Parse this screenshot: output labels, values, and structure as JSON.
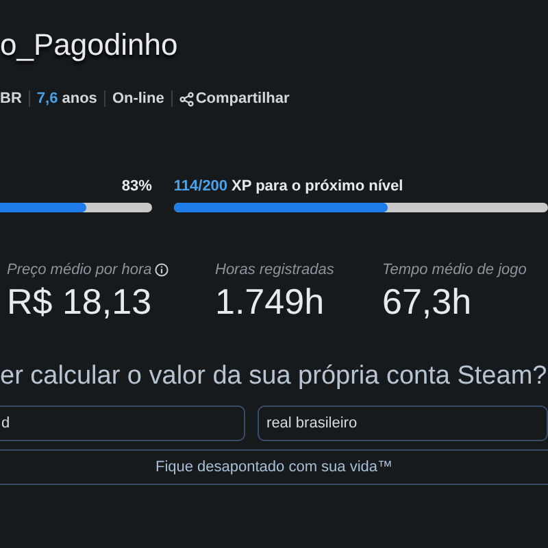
{
  "profile": {
    "name": "o_Pagodinho",
    "meta": [
      {
        "kind": "text",
        "text": "BR"
      },
      {
        "kind": "years",
        "value": "7,6",
        "text": "anos"
      },
      {
        "kind": "text",
        "text": "On-line"
      },
      {
        "kind": "share",
        "text": "Compartilhar"
      }
    ]
  },
  "progress": [
    {
      "reading": "83%",
      "level": 0.83
    },
    {
      "value": "114/200",
      "label": "XP para o próximo nível",
      "level": 0.57
    }
  ],
  "stats": [
    {
      "label": "Preço médio por hora",
      "info": true,
      "value": "R$ 18,13"
    },
    {
      "label": "Horas registradas",
      "info": false,
      "value": "1.749h"
    },
    {
      "label": "Tempo médio de jogo",
      "info": false,
      "value": "67,3h"
    }
  ],
  "calculator": {
    "question": "er calcular o valor da sua própria conta Steam?",
    "account_value": "d",
    "currency_value": "real brasileiro",
    "button": "Fique desapontado com sua vida™"
  }
}
